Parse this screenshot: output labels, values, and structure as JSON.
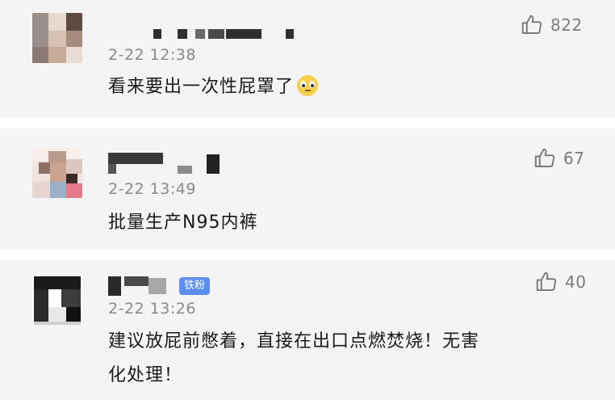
{
  "comments": [
    {
      "time": "2-22 12:38",
      "text": "看来要出一次性屁罩了",
      "emoji": "pleading-face-emoji",
      "likes": "822",
      "badge": ""
    },
    {
      "time": "2-22 13:49",
      "text": "批量生产N95内裤",
      "likes": "67",
      "badge": ""
    },
    {
      "time": "2-22 13:26",
      "text_line1": "建议放屁前憋着，直接在出口点燃焚烧！无害",
      "text_line2": "化处理！",
      "likes": "40",
      "badge": "铁粉"
    }
  ],
  "colors": {
    "background": "#f4f4f4",
    "separator": "#ffffff",
    "time_text": "#8a8a8a",
    "like_icon": "#7c7c7c",
    "badge": "#5b8ef0"
  },
  "icons": [
    "thumbs-up-icon",
    "pleading-face-emoji"
  ]
}
